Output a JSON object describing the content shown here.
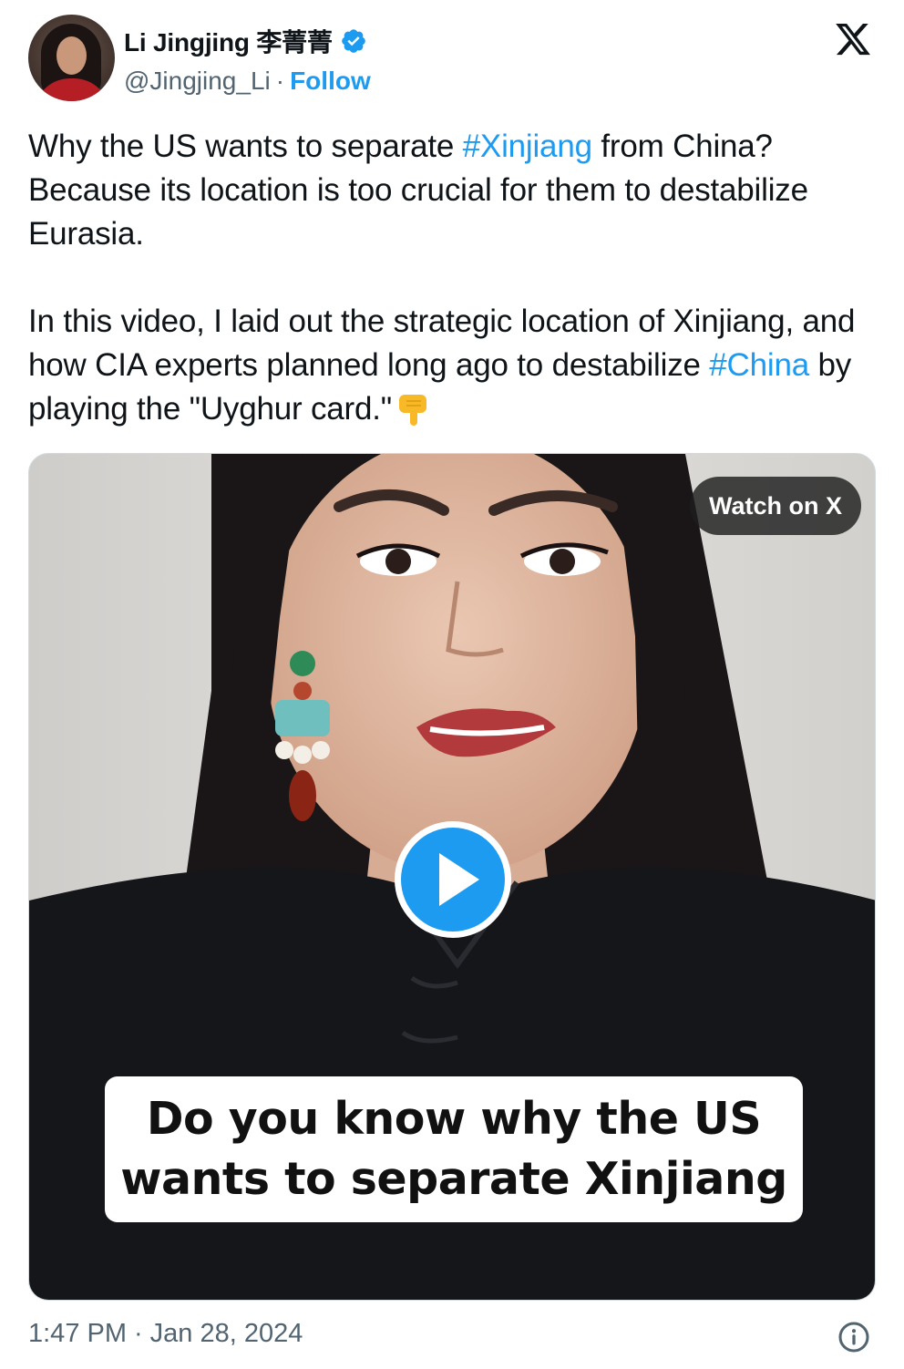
{
  "author": {
    "display_name": "Li Jingjing 李菁菁",
    "handle": "@Jingjing_Li",
    "separator": "·",
    "follow_label": "Follow",
    "verified": true,
    "verified_color": "#1d9bf0"
  },
  "tweet": {
    "paragraph1": {
      "part1": "Why the US wants to separate ",
      "hashtag1": "#Xinjiang",
      "part2": " from China? Because its location is too crucial for them to destabilize Eurasia."
    },
    "paragraph2": {
      "part1": "In this video, I laid out the strategic location of Xinjiang, and how CIA experts planned long ago to destabilize ",
      "hashtag2": "#China",
      "part2": " by playing the \"Uyghur card.\"",
      "emoji": "backhand-index-pointing-down"
    },
    "link_color": "#1d9bf0"
  },
  "media": {
    "type": "video",
    "watch_label": "Watch on X",
    "caption_line1": "Do you know why the US",
    "caption_line2": "wants to separate Xinjiang",
    "play_color": "#1d9bf0"
  },
  "footer": {
    "time": "1:47 PM",
    "separator": "·",
    "date": "Jan 28, 2024",
    "info_icon": "info-icon"
  },
  "brand": {
    "logo": "x-logo"
  }
}
